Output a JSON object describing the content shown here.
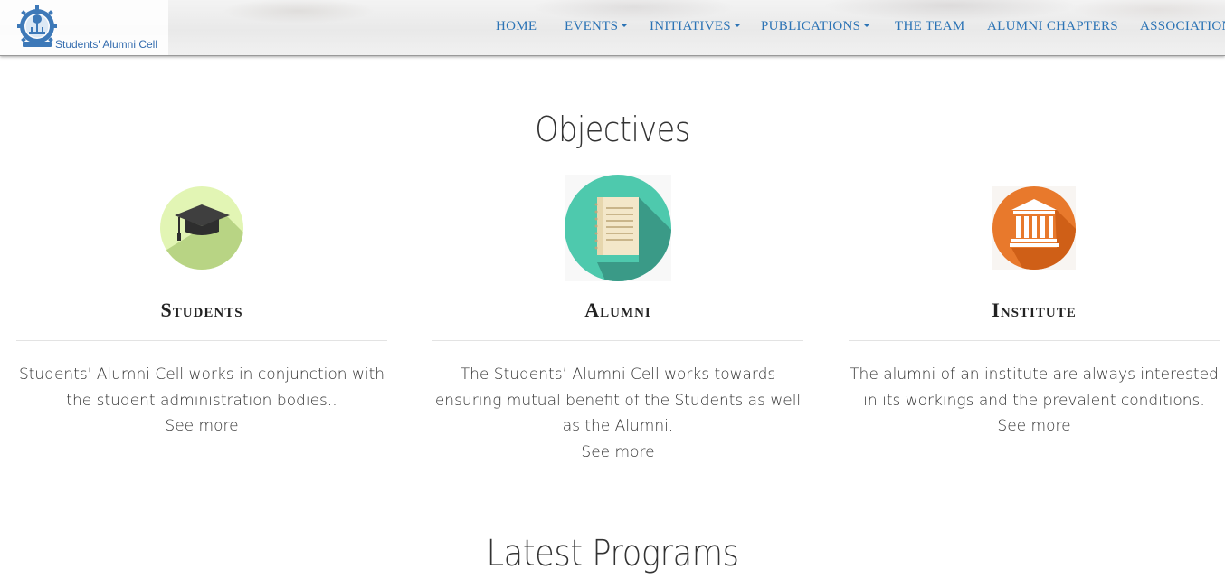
{
  "brand": {
    "name": "Students' Alumni Cell",
    "logo_icon": "institute-emblem-icon"
  },
  "nav": {
    "items": [
      {
        "label": "HOME",
        "dropdown": false
      },
      {
        "label": "EVENTS",
        "dropdown": true
      },
      {
        "label": "INITIATIVES",
        "dropdown": true
      },
      {
        "label": "PUBLICATIONS",
        "dropdown": true
      },
      {
        "label": "THE TEAM",
        "dropdown": false
      },
      {
        "label": "ALUMNI CHAPTERS",
        "dropdown": false
      },
      {
        "label": "ASSOCIATION",
        "dropdown": false
      }
    ]
  },
  "objectives": {
    "title": "Objectives",
    "columns": [
      {
        "title": "Students",
        "icon": "graduation-cap-icon",
        "icon_color": "#e2f5b4",
        "description": "Students' Alumni Cell works in conjunction with the student administration bodies..",
        "see_more": "See more"
      },
      {
        "title": "Alumni",
        "icon": "notebook-icon",
        "icon_color": "#4ec9ad",
        "description": "The Students’ Alumni Cell works towards ensuring mutual benefit of the Students as well as the Alumni.",
        "see_more": "See more"
      },
      {
        "title": "Institute",
        "icon": "institute-building-icon",
        "icon_color": "#e8792c",
        "description": "The alumni of an institute are always interested in its workings and the prevalent conditions.",
        "see_more": "See more"
      }
    ]
  },
  "programs": {
    "title": "Latest Programs"
  },
  "colors": {
    "nav_text": "#2b73b5",
    "brand_text": "#1f5ea8",
    "heading": "#333333"
  }
}
